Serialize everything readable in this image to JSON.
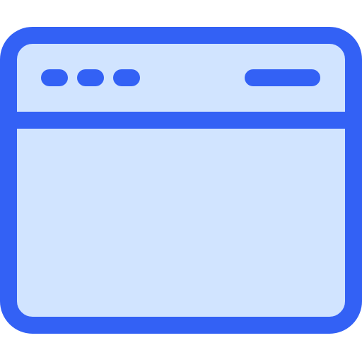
{
  "icon": {
    "name": "browser-window-icon",
    "colors": {
      "stroke": "#3361F5",
      "fill": "#D1E4FF",
      "background": "#FFFFFF"
    },
    "window_dots": [
      {
        "name": "window-dot-1"
      },
      {
        "name": "window-dot-2"
      },
      {
        "name": "window-dot-3"
      }
    ]
  }
}
